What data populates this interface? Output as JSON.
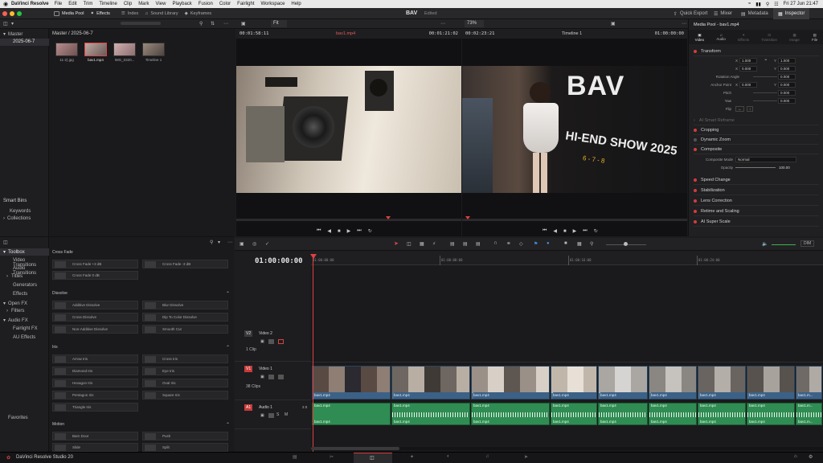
{
  "menubar": {
    "app": "DaVinci Resolve",
    "items": [
      "File",
      "Edit",
      "Trim",
      "Timeline",
      "Clip",
      "Mark",
      "View",
      "Playback",
      "Fusion",
      "Color",
      "Fairlight",
      "Workspace",
      "Help"
    ],
    "clock": "Fri 27 Jun 21:47"
  },
  "toolbar": {
    "media_pool": "Media Pool",
    "effects": "Effects",
    "index": "Index",
    "sound_library": "Sound Library",
    "keyframes": "Keyframes",
    "project": "BAV",
    "project_state": "Edited",
    "quick_export": "Quick Export",
    "mixer": "Mixer",
    "metadata": "Metadata",
    "inspector": "Inspector"
  },
  "media_pool": {
    "master_label": "Master",
    "bin": "2025-06-7",
    "path": "Master / 2025-06-7",
    "clips": [
      "11-2).jpg",
      "bav1.mp4",
      "IMG_0320...",
      "Timeline 1"
    ],
    "smart_bins": "Smart Bins",
    "smart_items": [
      "Keywords",
      "Collections"
    ]
  },
  "source_viewer": {
    "zoom": "Fit",
    "duration": "00:01:58:11",
    "clip": "bav1.mp4",
    "timecode": "00:01:21:02"
  },
  "timeline_viewer": {
    "zoom": "73%",
    "duration": "00:02:23:21",
    "name": "Timeline 1",
    "timecode": "01:00:00:00"
  },
  "inspector": {
    "title": "Media Pool - bav1.mp4",
    "tabs": [
      "Video",
      "Audio",
      "Effects",
      "Transition",
      "Image",
      "File"
    ],
    "transform": "Transform",
    "params": [
      {
        "label": "Zoom",
        "x": "1.000",
        "y": "1.000"
      },
      {
        "label": "Position",
        "x": "0.000",
        "y": "0.000"
      },
      {
        "label": "Rotation Angle",
        "v": "0.000"
      },
      {
        "label": "Anchor Point",
        "x": "0.000",
        "y": "0.000"
      },
      {
        "label": "Pitch",
        "v": "0.000"
      },
      {
        "label": "Yaw",
        "v": "0.000"
      },
      {
        "label": "Flip"
      }
    ],
    "smart_reframe": "AI Smart Reframe",
    "cropping": "Cropping",
    "dynamic_zoom": "Dynamic Zoom",
    "composite": "Composite",
    "composite_mode_label": "Composite Mode",
    "composite_mode": "Normal",
    "opacity_label": "Opacity",
    "opacity": "100.00",
    "sections": [
      "Speed Change",
      "Stabilization",
      "Lens Correction",
      "Retime and Scaling",
      "AI Super Scale"
    ]
  },
  "effects": {
    "toolbox": "Toolbox",
    "nav": [
      "Video Transitions",
      "Audio Transitions",
      "Titles",
      "Generators",
      "Effects",
      "Open FX",
      "Filters",
      "Audio FX",
      "Fairlight FX",
      "AU Effects"
    ],
    "favorites": "Favorites",
    "cross_fade": "Cross Fade",
    "cross_fade_items": [
      "Cross Fade +3 dB",
      "Cross Fade -3 dB",
      "Cross Fade 0 dB"
    ],
    "dissolve": "Dissolve",
    "dissolve_items": [
      "Additive Dissolve",
      "Blur Dissolve",
      "Cross Dissolve",
      "Dip To Color Dissolve",
      "Non-Additive Dissolve",
      "Smooth Cut"
    ],
    "iris": "Iris",
    "iris_items": [
      "Arrow Iris",
      "Cross Iris",
      "Diamond Iris",
      "Eye Iris",
      "Hexagon Iris",
      "Oval Iris",
      "Pentagon Iris",
      "Square Iris",
      "Triangle Iris"
    ],
    "motion": "Motion",
    "motion_items": [
      "Barn Door",
      "Push",
      "Slide",
      "Split"
    ]
  },
  "timeline": {
    "timecode": "01:00:00:00",
    "ruler": [
      "01:00:00:00",
      "01:00:08:00",
      "01:00:16:00",
      "01:00:24:00"
    ],
    "v2": {
      "id": "V2",
      "name": "Video 2",
      "count": "1 Clip"
    },
    "v1": {
      "id": "V1",
      "name": "Video 1",
      "count": "38 Clips"
    },
    "a1": {
      "id": "A1",
      "name": "Audio 1",
      "level": "2.0"
    },
    "clip_name": "bav1.mp4",
    "clip_name_short": "bav1.m...",
    "dim": "DIM"
  },
  "pagebar": {
    "app": "DaVinci Resolve Studio 20"
  }
}
